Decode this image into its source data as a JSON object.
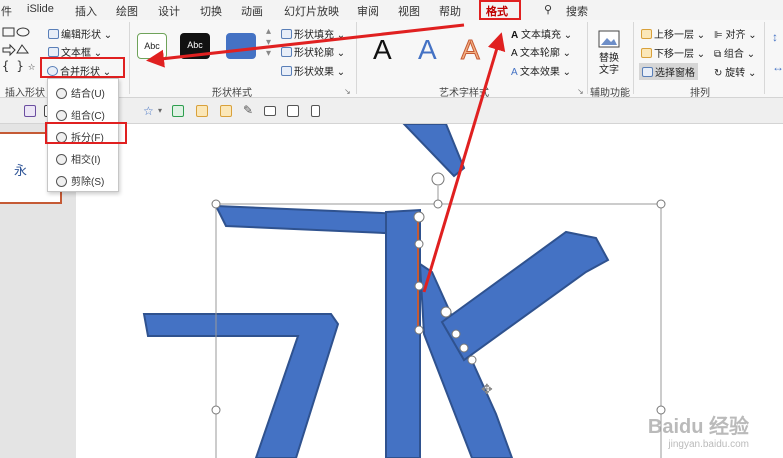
{
  "menu": {
    "items": [
      "件",
      "iSlide",
      "插入",
      "绘图",
      "设计",
      "切换",
      "动画",
      "幻灯片放映",
      "审阅",
      "视图",
      "帮助",
      "格式"
    ],
    "search_label": "搜索"
  },
  "ribbon": {
    "insert_shape": {
      "edit_shape": "编辑形状",
      "text_box": "文本框",
      "merge_shapes": "合并形状",
      "group_label": "插入形状"
    },
    "shape_styles": {
      "thumb_text": "Abc",
      "fill": "形状填充",
      "outline": "形状轮廓",
      "effect": "形状效果",
      "group_label": "形状样式"
    },
    "wordart": {
      "letters": [
        "A",
        "A",
        "A"
      ],
      "text_fill": "文本填充",
      "text_outline": "文本轮廓",
      "text_effect": "文本效果",
      "group_label": "艺术字样式"
    },
    "accessibility": {
      "alt_text": "替换文字",
      "group_label": "辅助功能"
    },
    "arrange": {
      "bring_forward": "上移一层",
      "send_backward": "下移一层",
      "selection_pane": "选择窗格",
      "align": "对齐",
      "group": "组合",
      "rotate": "旋转",
      "group_label": "排列"
    }
  },
  "dropdown": {
    "items": [
      "结合(U)",
      "组合(C)",
      "拆分(F)",
      "相交(I)",
      "剪除(S)"
    ]
  },
  "slide": {
    "character": "永",
    "thumbnail_character": "永"
  },
  "watermark": {
    "logo": "Baidu 经验",
    "url": "jingyan.baidu.com"
  },
  "colors": {
    "shape_blue": "#4472c4",
    "shape_edge": "#2f528f",
    "highlight_red": "#e02020",
    "accent_orange": "#c55a35"
  }
}
